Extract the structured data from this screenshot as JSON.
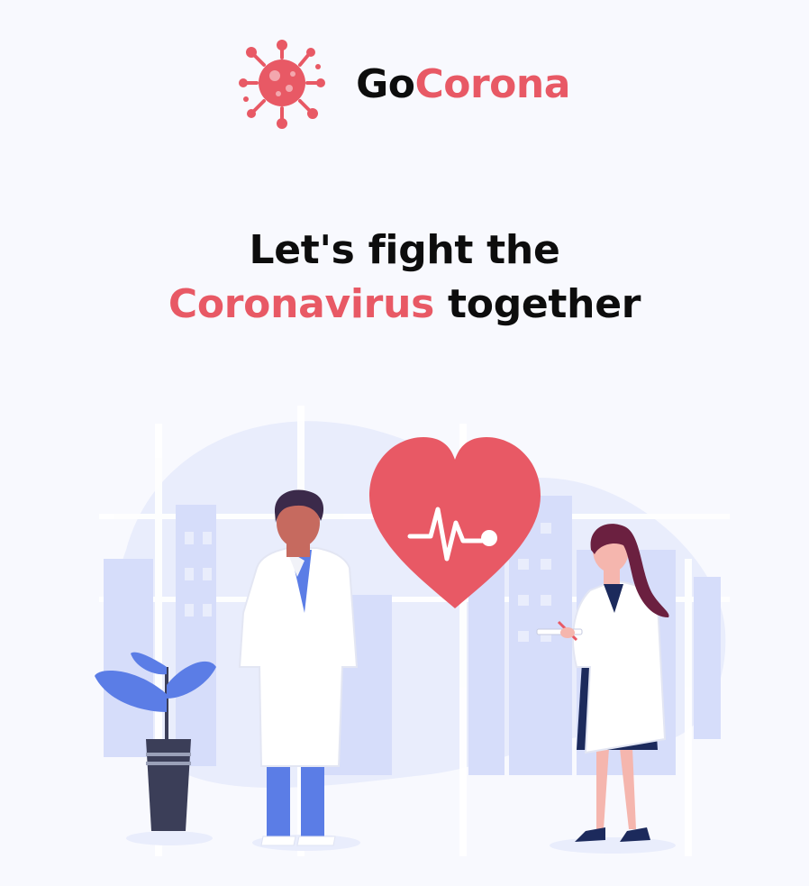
{
  "brand": {
    "part1": "Go",
    "part2": "Corona"
  },
  "hero": {
    "line1": "Let's fight the",
    "line2_highlight": "Coronavirus",
    "line2_rest": "together"
  },
  "colors": {
    "accent": "#e85965",
    "text": "#0d0d0d",
    "background": "#f8f9fe",
    "illustration_blue": "#5b7de6"
  }
}
